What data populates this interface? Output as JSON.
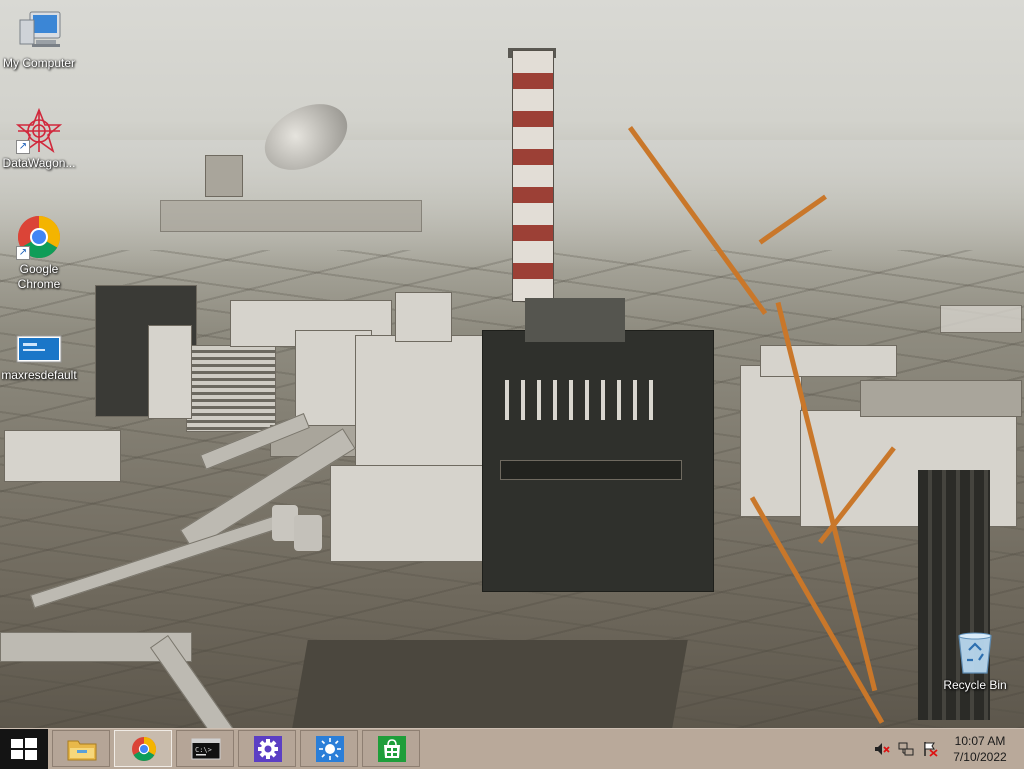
{
  "desktop": {
    "icons": [
      {
        "name": "my-computer",
        "label": "My Computer",
        "icon": "computer-icon"
      },
      {
        "name": "datawagon",
        "label": "DataWagon...",
        "icon": "datawagon-icon"
      },
      {
        "name": "google-chrome",
        "label": "Google Chrome",
        "icon": "chrome-icon"
      },
      {
        "name": "maxresdefault",
        "label": "maxresdefault",
        "icon": "image-file-icon"
      },
      {
        "name": "recycle-bin",
        "label": "Recycle Bin",
        "icon": "recycle-bin-icon"
      }
    ]
  },
  "taskbar": {
    "start": {
      "icon": "windows-logo-icon"
    },
    "buttons": [
      {
        "name": "file-explorer",
        "icon": "folder-icon",
        "active": false
      },
      {
        "name": "chrome",
        "icon": "chrome-icon",
        "active": true
      },
      {
        "name": "command-prompt",
        "icon": "cmd-icon",
        "active": false
      },
      {
        "name": "settings",
        "icon": "gear-icon",
        "active": false
      },
      {
        "name": "weather",
        "icon": "sun-icon",
        "active": false
      },
      {
        "name": "store",
        "icon": "store-icon",
        "active": false
      }
    ],
    "tray": {
      "icons": [
        "volume-muted-icon",
        "network-icon",
        "action-center-icon"
      ],
      "time": "10:07 AM",
      "date": "7/10/2022"
    }
  },
  "colors": {
    "taskbar_bg": "#b9a99a",
    "start_bg": "#141414",
    "icon_label": "#ffffff",
    "settings_tile": "#5b3fc4",
    "weather_tile": "#2a7ed8",
    "store_tile": "#1e9e3a"
  }
}
